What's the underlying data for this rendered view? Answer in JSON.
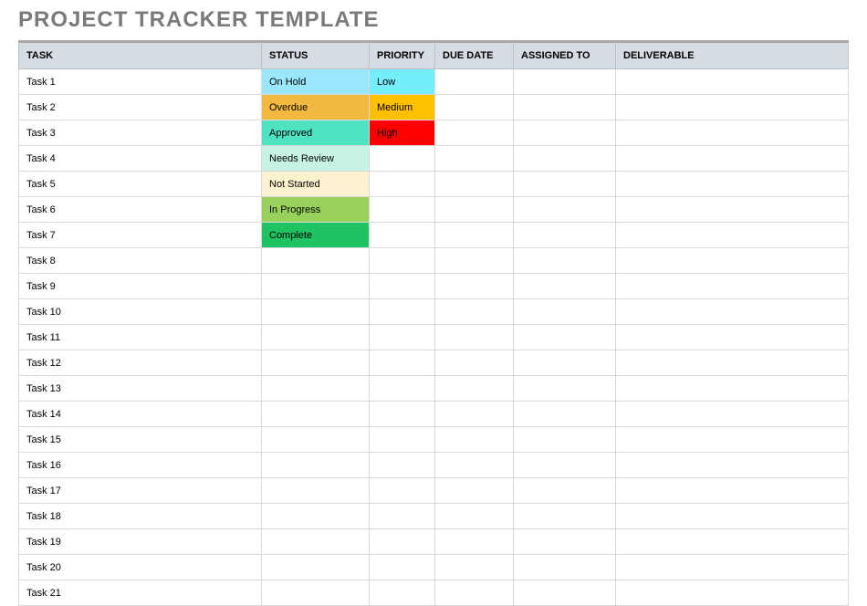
{
  "title": "PROJECT TRACKER TEMPLATE",
  "columns": {
    "task": "TASK",
    "status": "STATUS",
    "priority": "PRIORITY",
    "due": "DUE DATE",
    "assigned": "ASSIGNED TO",
    "deliverable": "DELIVERABLE"
  },
  "status_colors": {
    "On Hold": "s-onhold",
    "Overdue": "s-overdue",
    "Approved": "s-approved",
    "Needs Review": "s-needs",
    "Not Started": "s-notstarted",
    "In Progress": "s-inprogress",
    "Complete": "s-complete"
  },
  "priority_colors": {
    "Low": "p-low",
    "Medium": "p-medium",
    "High": "p-high"
  },
  "rows": [
    {
      "task": "Task 1",
      "status": "On Hold",
      "priority": "Low",
      "due": "",
      "assigned": "",
      "deliverable": ""
    },
    {
      "task": "Task 2",
      "status": "Overdue",
      "priority": "Medium",
      "due": "",
      "assigned": "",
      "deliverable": ""
    },
    {
      "task": "Task 3",
      "status": "Approved",
      "priority": "High",
      "due": "",
      "assigned": "",
      "deliverable": ""
    },
    {
      "task": "Task 4",
      "status": "Needs Review",
      "priority": "",
      "due": "",
      "assigned": "",
      "deliverable": ""
    },
    {
      "task": "Task 5",
      "status": "Not Started",
      "priority": "",
      "due": "",
      "assigned": "",
      "deliverable": ""
    },
    {
      "task": "Task 6",
      "status": "In Progress",
      "priority": "",
      "due": "",
      "assigned": "",
      "deliverable": ""
    },
    {
      "task": "Task 7",
      "status": "Complete",
      "priority": "",
      "due": "",
      "assigned": "",
      "deliverable": ""
    },
    {
      "task": "Task 8",
      "status": "",
      "priority": "",
      "due": "",
      "assigned": "",
      "deliverable": ""
    },
    {
      "task": "Task 9",
      "status": "",
      "priority": "",
      "due": "",
      "assigned": "",
      "deliverable": ""
    },
    {
      "task": "Task 10",
      "status": "",
      "priority": "",
      "due": "",
      "assigned": "",
      "deliverable": ""
    },
    {
      "task": "Task 11",
      "status": "",
      "priority": "",
      "due": "",
      "assigned": "",
      "deliverable": ""
    },
    {
      "task": "Task 12",
      "status": "",
      "priority": "",
      "due": "",
      "assigned": "",
      "deliverable": ""
    },
    {
      "task": "Task 13",
      "status": "",
      "priority": "",
      "due": "",
      "assigned": "",
      "deliverable": ""
    },
    {
      "task": "Task 14",
      "status": "",
      "priority": "",
      "due": "",
      "assigned": "",
      "deliverable": ""
    },
    {
      "task": "Task 15",
      "status": "",
      "priority": "",
      "due": "",
      "assigned": "",
      "deliverable": ""
    },
    {
      "task": "Task 16",
      "status": "",
      "priority": "",
      "due": "",
      "assigned": "",
      "deliverable": ""
    },
    {
      "task": "Task 17",
      "status": "",
      "priority": "",
      "due": "",
      "assigned": "",
      "deliverable": ""
    },
    {
      "task": "Task 18",
      "status": "",
      "priority": "",
      "due": "",
      "assigned": "",
      "deliverable": ""
    },
    {
      "task": "Task 19",
      "status": "",
      "priority": "",
      "due": "",
      "assigned": "",
      "deliverable": ""
    },
    {
      "task": "Task 20",
      "status": "",
      "priority": "",
      "due": "",
      "assigned": "",
      "deliverable": ""
    },
    {
      "task": "Task 21",
      "status": "",
      "priority": "",
      "due": "",
      "assigned": "",
      "deliverable": ""
    }
  ]
}
